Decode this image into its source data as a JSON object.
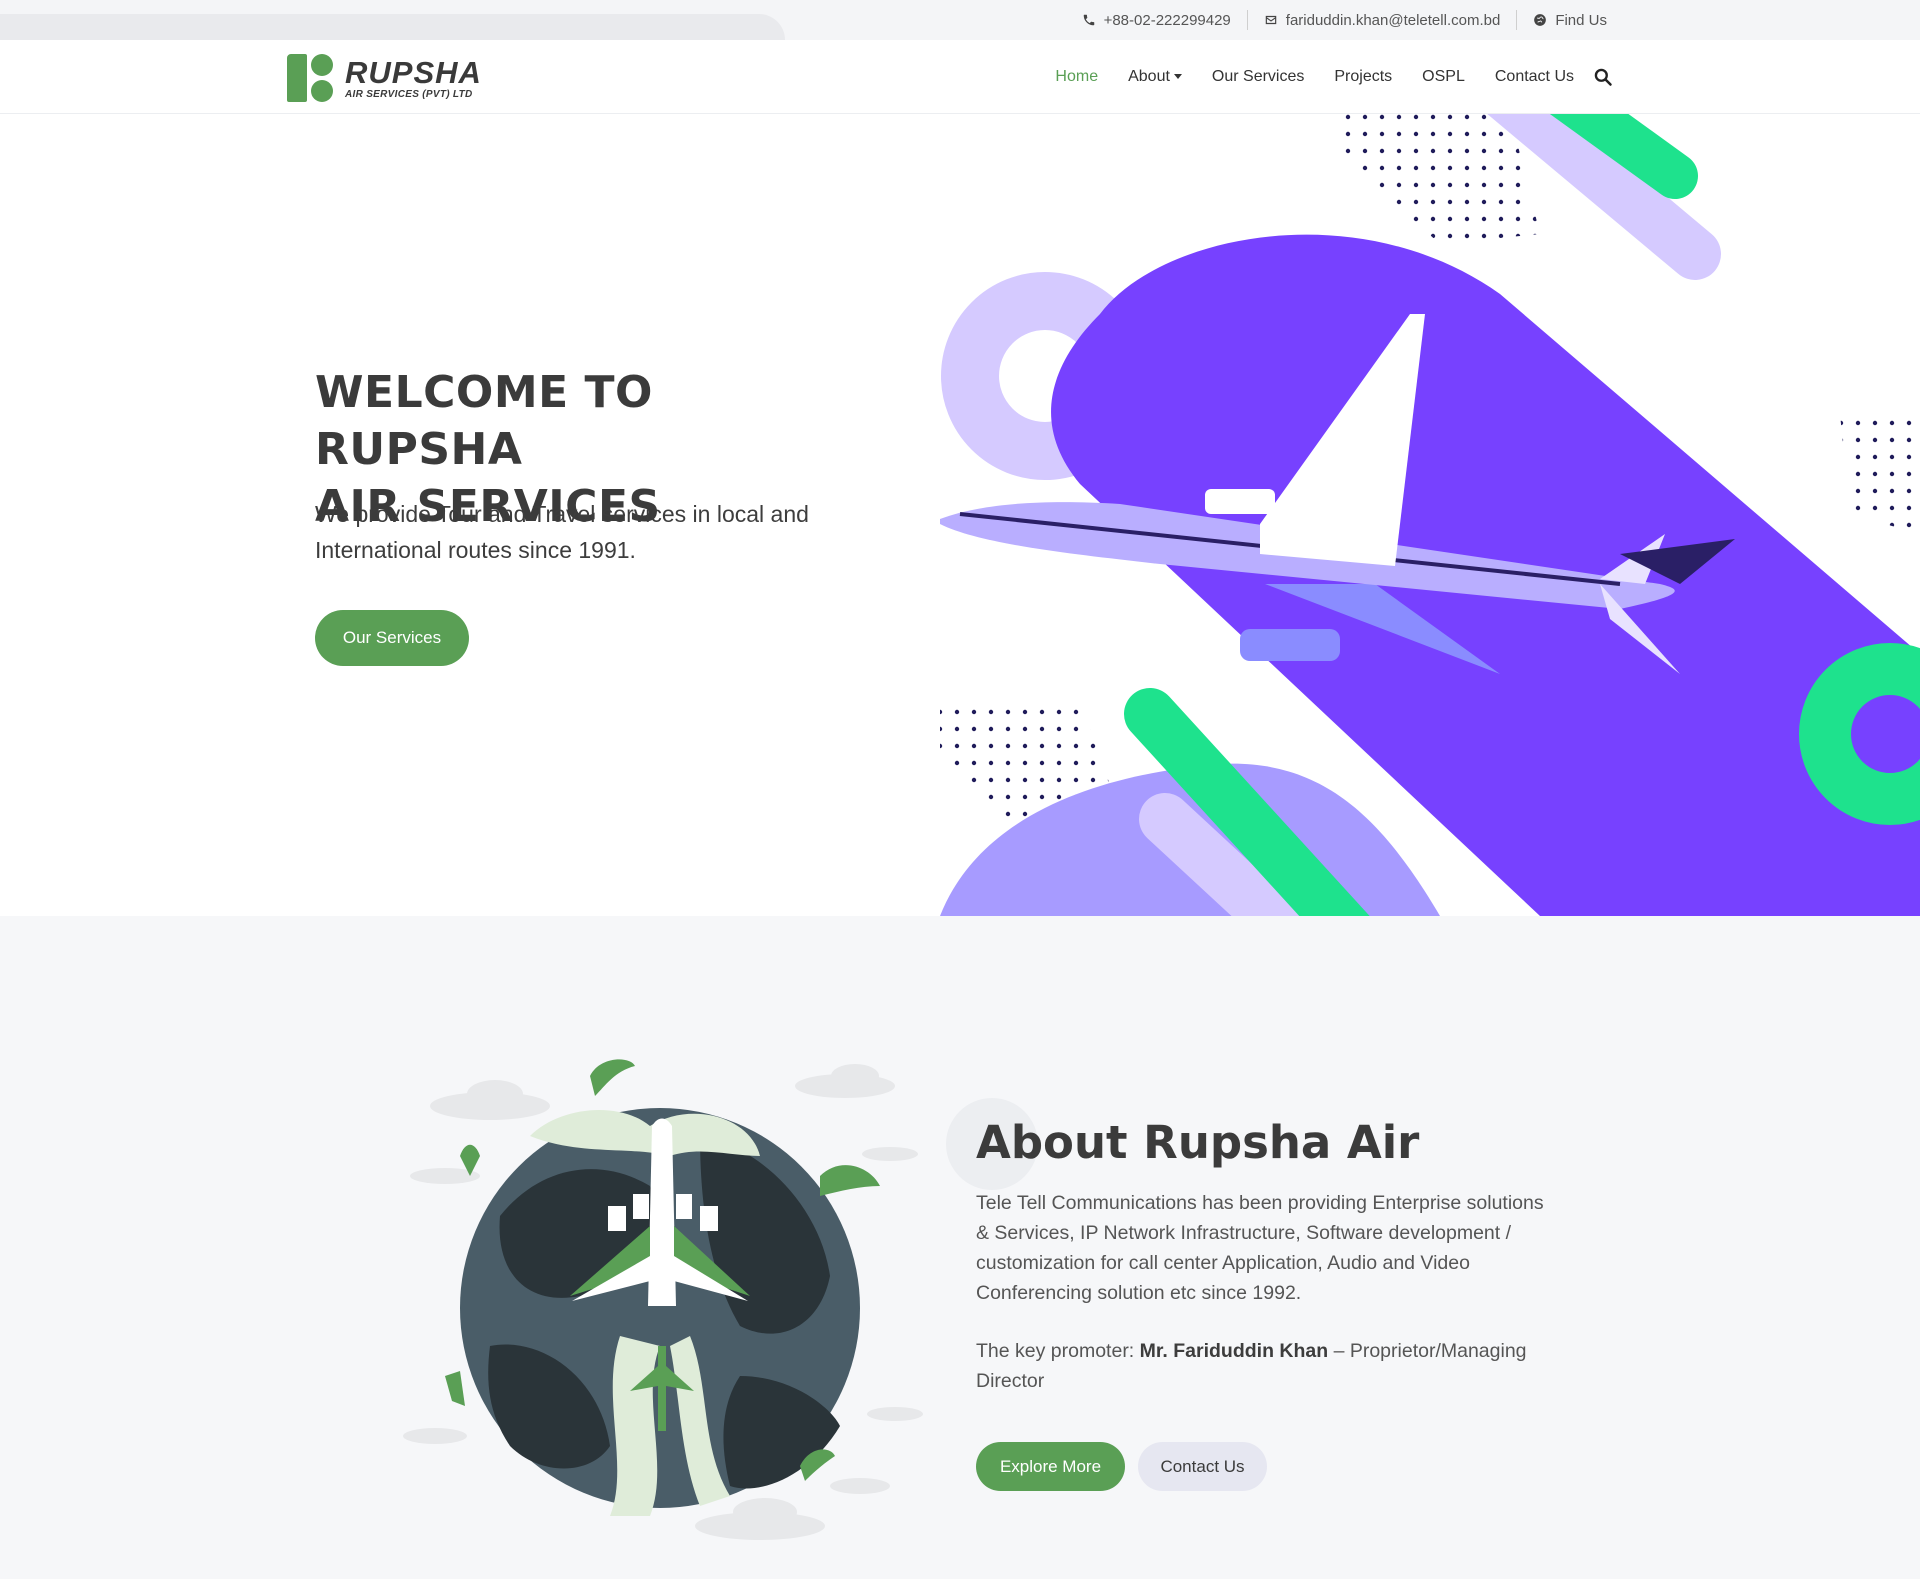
{
  "topbar": {
    "phone": "+88-02-222299429",
    "email": "fariduddin.khan@teletell.com.bd",
    "find": "Find Us"
  },
  "brand": {
    "name": "RUPSHA",
    "sub": "AIR SERVICES (PVT) LTD"
  },
  "nav": {
    "home": "Home",
    "about": "About",
    "services": "Our Services",
    "projects": "Projects",
    "ospl": "OSPL",
    "contact": "Contact Us"
  },
  "hero": {
    "title_line1": "WELCOME TO RUPSHA",
    "title_line2": "AIR SERVICES",
    "subtitle": "We provide Tour and Travel services in local and International routes since 1991.",
    "button": "Our Services"
  },
  "about": {
    "title": "About Rupsha Air",
    "description": "Tele Tell Communications has been providing Enterprise solutions & Services, IP Network Infrastructure, Software development / customization for call center Application, Audio and Video Conferencing solution etc since 1992.",
    "promoter_prefix": "The key promoter:",
    "promoter_name": "Mr. Fariduddin Khan",
    "promoter_suffix": "– Proprietor/Managing Director",
    "explore_button": "Explore More",
    "contact_button": "Contact Us"
  },
  "icons": {
    "phone": "phone-icon",
    "email": "envelope-icon",
    "globe": "globe-icon",
    "search": "search-icon"
  },
  "colors": {
    "brand_green": "#5a9f55",
    "hero_purple": "#7741ff",
    "accent_mint": "#1ee28d"
  }
}
